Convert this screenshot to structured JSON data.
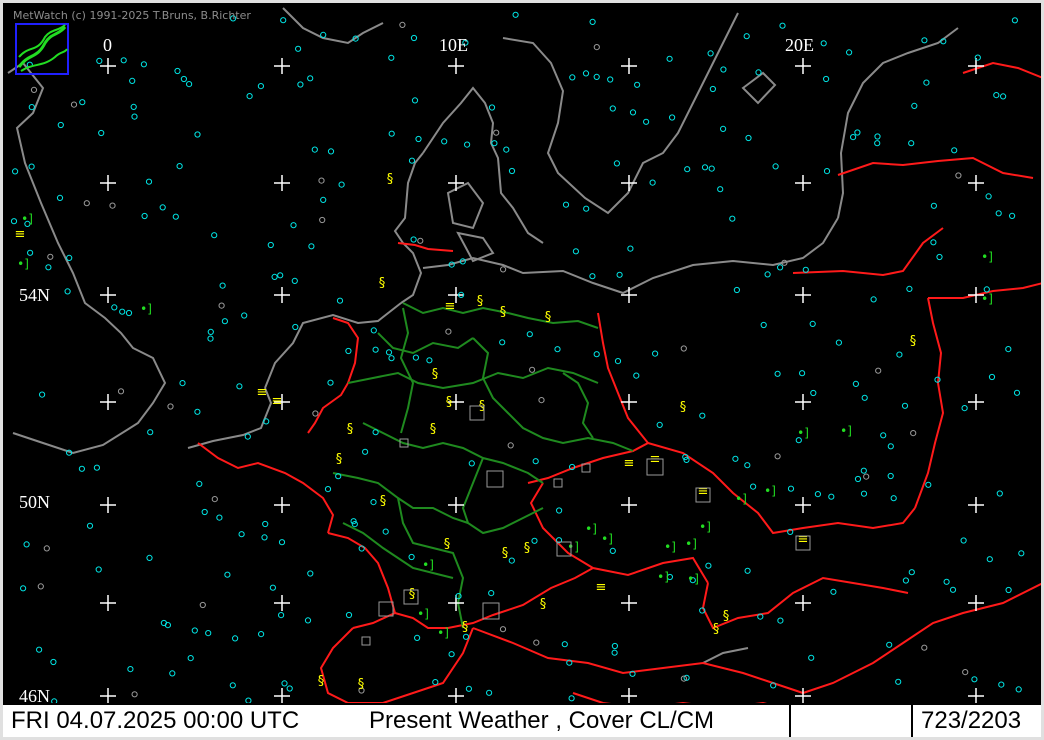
{
  "app": {
    "copyright": "MetWatch  (c) 1991-2025 T.Bruns, B.Richter",
    "logo_icon": "metwatch-logo-icon"
  },
  "map": {
    "longitude_labels": [
      "0",
      "10E",
      "20E"
    ],
    "latitude_labels": [
      "54N",
      "50N",
      "46N"
    ],
    "colors": {
      "background": "#000000",
      "coastline": "#8a8a8a",
      "country_border": "#ff1a1a",
      "state_border": "#1f8a1f",
      "station_ok": "#00e5e5",
      "weather_yellow": "#ffff00",
      "weather_green": "#22dd22",
      "grid_cross": "#ffffff"
    }
  },
  "status": {
    "datetime": "FRI 04.07.2025 00:00 UTC",
    "product": "Present Weather     , Cover CL/CM",
    "count": "723/2203"
  }
}
